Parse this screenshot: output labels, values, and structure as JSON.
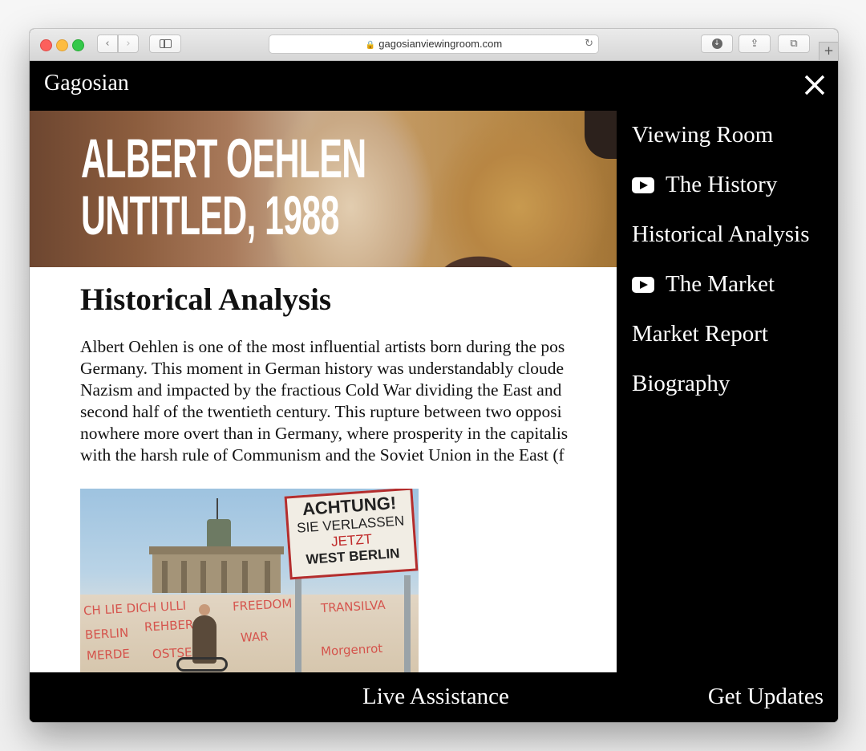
{
  "browser": {
    "url": "gagosianviewingroom.com",
    "icons": {
      "back": "chevron-left-icon",
      "forward": "chevron-right-icon",
      "sidebar": "sidebar-icon",
      "lock": "lock-icon",
      "reload": "reload-icon",
      "download": "download-icon",
      "share": "share-icon",
      "tabs": "tabs-icon",
      "new_tab": "plus-icon"
    }
  },
  "site": {
    "logo": "Gagosian",
    "close_icon": "close-icon"
  },
  "hero": {
    "title_line1": "ALBERT OEHLEN",
    "title_line2": "UNTITLED, 1988"
  },
  "article": {
    "heading": "Historical Analysis",
    "lines": [
      "Albert Oehlen is one of the most influential artists born during the pos",
      "Germany. This moment in German history was understandably cloude",
      "Nazism and impacted by the fractious Cold War dividing the East and",
      "second half of the twentieth century. This rupture between two opposi",
      "nowhere more overt than in Germany, where prosperity in the capitalis",
      "with the harsh rule of Communism and the Soviet Union in the East (f"
    ],
    "photo_sign": {
      "line1": "ACHTUNG!",
      "line2": "SIE VERLASSEN",
      "line3": "JETZT",
      "line4": "WEST BERLIN"
    }
  },
  "nav": {
    "items": [
      {
        "label": "Viewing Room",
        "icon": ""
      },
      {
        "label": "The History",
        "icon": "youtube-play-icon"
      },
      {
        "label": "Historical Analysis",
        "icon": ""
      },
      {
        "label": "The Market",
        "icon": "youtube-play-icon"
      },
      {
        "label": "Market Report",
        "icon": ""
      },
      {
        "label": "Biography",
        "icon": ""
      }
    ]
  },
  "footer": {
    "live_assistance": "Live Assistance",
    "get_updates": "Get Updates"
  },
  "colors": {
    "page_background": "#000000",
    "content_background": "#ffffff",
    "text_light": "#ffffff",
    "text_dark": "#111111"
  }
}
